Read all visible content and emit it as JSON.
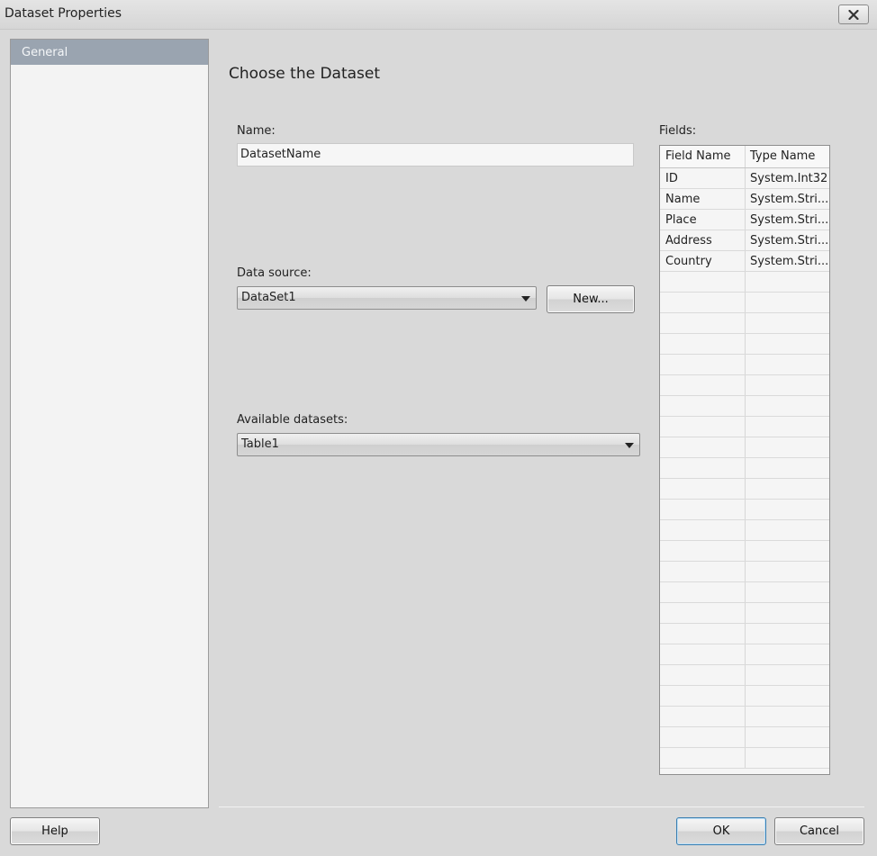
{
  "window": {
    "title": "Dataset Properties"
  },
  "sidebar": {
    "items": [
      {
        "label": "General"
      }
    ]
  },
  "main": {
    "heading": "Choose the Dataset",
    "name": {
      "label": "Name:",
      "value": "DatasetName"
    },
    "data_source": {
      "label": "Data source:",
      "selected": "DataSet1",
      "new_button": "New..."
    },
    "available_datasets": {
      "label": "Available datasets:",
      "selected": "Table1"
    }
  },
  "fields": {
    "label": "Fields:",
    "columns": [
      "Field Name",
      "Type Name"
    ],
    "rows": [
      {
        "field": "ID",
        "type": "System.Int32"
      },
      {
        "field": "Name",
        "type": "System.Stri..."
      },
      {
        "field": "Place",
        "type": "System.Stri..."
      },
      {
        "field": "Address",
        "type": "System.Stri..."
      },
      {
        "field": "Country",
        "type": "System.Stri..."
      }
    ]
  },
  "footer": {
    "help": "Help",
    "ok": "OK",
    "cancel": "Cancel"
  }
}
